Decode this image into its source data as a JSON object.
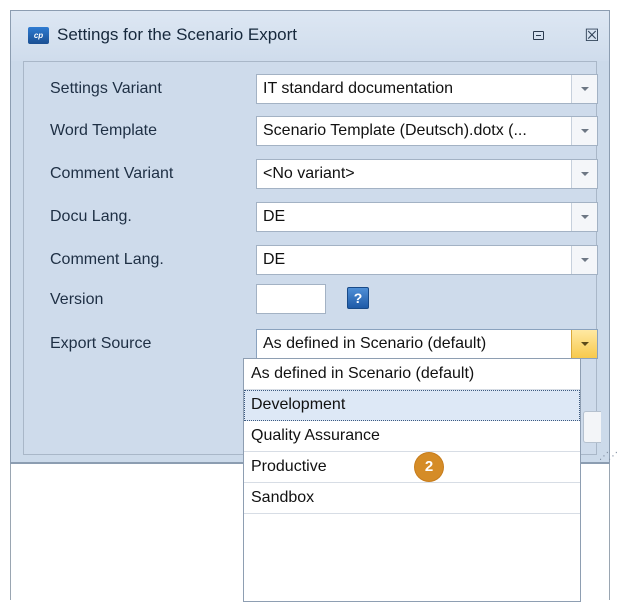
{
  "window": {
    "title": "Settings for the Scenario Export",
    "logo_text": "cp",
    "restore_icon": "restore-icon",
    "close_glyph": "☒"
  },
  "fields": [
    {
      "label": "Settings Variant",
      "value": "IT standard documentation"
    },
    {
      "label": "Word Template",
      "value": "Scenario Template (Deutsch).dotx (..."
    },
    {
      "label": "Comment Variant",
      "value": "<No variant>"
    },
    {
      "label": "Docu Lang.",
      "value": "DE"
    },
    {
      "label": "Comment Lang.",
      "value": "DE"
    }
  ],
  "version": {
    "label": "Version",
    "value": "",
    "help_glyph": "?"
  },
  "export_source": {
    "label": "Export Source",
    "value": "As defined in Scenario (default)",
    "options": [
      "As defined in Scenario (default)",
      "Development",
      "Quality Assurance",
      "Productive",
      "Sandbox"
    ],
    "highlighted_index": 1
  },
  "callout": {
    "number": "2",
    "color": "#d58c27"
  },
  "colors": {
    "dialog_bg": "#ccdaea",
    "dropdown_active": "#f7c94c",
    "highlight": "#dde8f6"
  }
}
